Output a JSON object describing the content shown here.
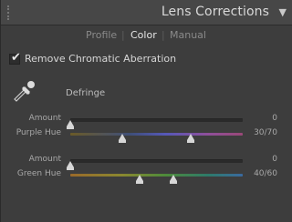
{
  "header": {
    "title": "Lens Corrections"
  },
  "tabs": [
    {
      "label": "Profile",
      "active": false
    },
    {
      "label": "Color",
      "active": true
    },
    {
      "label": "Manual",
      "active": false
    }
  ],
  "separator": "|",
  "remove_ca": {
    "label": "Remove Chromatic Aberration",
    "checked": true,
    "check_glyph": "✔"
  },
  "defringe": {
    "label": "Defringe"
  },
  "sliders": {
    "purple_amount": {
      "label": "Amount",
      "value": "0",
      "position": 0.0
    },
    "purple_hue": {
      "label": "Purple Hue",
      "value": "30/70",
      "low": 0.3,
      "high": 0.7
    },
    "green_amount": {
      "label": "Amount",
      "value": "0",
      "position": 0.0
    },
    "green_hue": {
      "label": "Green Hue",
      "value": "40/60",
      "low": 0.4,
      "high": 0.6
    }
  },
  "icons": {
    "collapse": "triangle-down",
    "eyedropper": "eyedropper-tool"
  }
}
